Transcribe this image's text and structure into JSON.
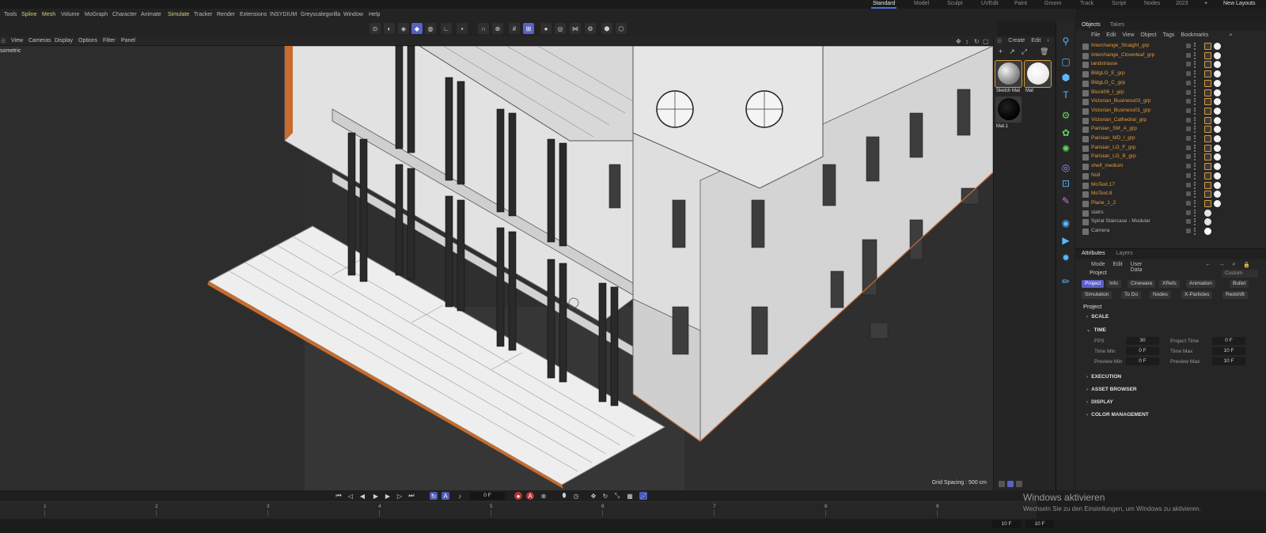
{
  "layouts": {
    "tabs": [
      "Standard",
      "Model",
      "Sculpt",
      "UVEdit",
      "Paint",
      "Groom",
      "Track",
      "Script",
      "Nodes",
      "2023"
    ],
    "plus": "+",
    "new_layouts": "New Layouts"
  },
  "menu": [
    "Tools",
    "Spline",
    "Mesh",
    "Volume",
    "MoGraph",
    "Character",
    "Animate",
    "Simulate",
    "Tracker",
    "Render",
    "Extensions",
    "INSYDIUM",
    "Greyscalegorilla",
    "Window",
    "Help"
  ],
  "viewport": {
    "menu": [
      "View",
      "Cameras",
      "Display",
      "Options",
      "Filter",
      "Panel"
    ],
    "label": "sometric",
    "grid_spacing": "Grid Spacing : 500 cm"
  },
  "materials": {
    "menu": [
      "Create",
      "Edit"
    ],
    "items": [
      {
        "name": "Sketch Mat"
      },
      {
        "name": "Mat"
      },
      {
        "name": "Mat.1"
      }
    ]
  },
  "objects": {
    "tabs": [
      "Objects",
      "Takes"
    ],
    "menu": [
      "File",
      "Edit",
      "View",
      "Object",
      "Tags",
      "Bookmarks"
    ],
    "rows": [
      {
        "name": "Interchange_Straight_grp",
        "color": "orange"
      },
      {
        "name": "Interchange_Cloverleaf_grp",
        "color": "orange"
      },
      {
        "name": "landstrasse",
        "color": "orange"
      },
      {
        "name": "BldgLG_E_grp",
        "color": "orange"
      },
      {
        "name": "BldgLG_C_grp",
        "color": "orange"
      },
      {
        "name": "Block06_I_grp",
        "color": "orange"
      },
      {
        "name": "Victorian_Business03_grp",
        "color": "orange"
      },
      {
        "name": "Victorian_Business01_grp",
        "color": "orange"
      },
      {
        "name": "Victorian_Cathedral_grp",
        "color": "orange"
      },
      {
        "name": "Parisian_SM_A_grp",
        "color": "orange"
      },
      {
        "name": "Parisian_MD_I_grp",
        "color": "orange"
      },
      {
        "name": "Parisian_LG_F_grp",
        "color": "orange"
      },
      {
        "name": "Parisian_LG_B_grp",
        "color": "orange"
      },
      {
        "name": "shelf_medium",
        "color": "orange"
      },
      {
        "name": "Null",
        "color": "orange"
      },
      {
        "name": "MoText.17",
        "color": "orange"
      },
      {
        "name": "MoText.8",
        "color": "orange"
      },
      {
        "name": "Plane_1_2",
        "color": "orange"
      },
      {
        "name": "stairs",
        "color": "grey"
      },
      {
        "name": "Spiral Staircase - Modular",
        "color": "grey"
      },
      {
        "name": "Camera",
        "color": "grey"
      }
    ]
  },
  "attributes": {
    "tabs": [
      "Attributes",
      "Layers"
    ],
    "menu": [
      "Mode",
      "Edit",
      "User Data"
    ],
    "object": "Project",
    "preset": "Custom",
    "pills_row1": [
      "Project",
      "Info",
      "Cineware",
      "XRefs",
      "Animation",
      "Bullet"
    ],
    "pills_row2": [
      "Simulation",
      "To Do",
      "Nodes",
      "X-Particles",
      "Redshift"
    ],
    "title": "Project",
    "sections": [
      "SCALE",
      "TIME",
      "EXECUTION",
      "ASSET BROWSER",
      "DISPLAY",
      "COLOR MANAGEMENT"
    ],
    "time": {
      "fps_label": "FPS",
      "fps": "30",
      "project_time_label": "Project Time",
      "project_time": "0 F",
      "time_min_label": "Time Min",
      "time_min": "0 F",
      "time_max_label": "Time Max",
      "time_max": "10 F",
      "preview_min_label": "Preview Min",
      "preview_min": "0 F",
      "preview_max_label": "Preview Max",
      "preview_max": "10 F"
    }
  },
  "timeline": {
    "current_frame": "0 F",
    "ticks": [
      "1",
      "2",
      "3",
      "4",
      "5",
      "6",
      "7",
      "8",
      "9"
    ],
    "end_a": "10 F",
    "end_b": "10 F"
  },
  "watermark": {
    "title": "Windows aktivieren",
    "subtitle": "Wechseln Sie zu den Einstellungen, um Windows zu aktivieren."
  }
}
